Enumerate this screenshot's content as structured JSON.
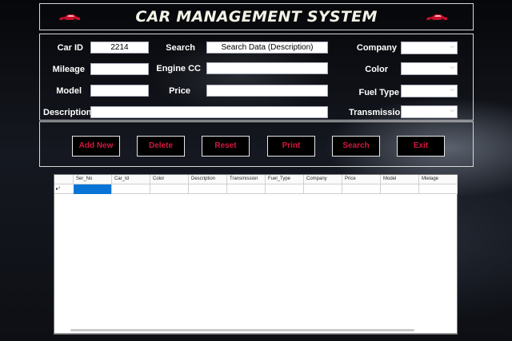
{
  "header": {
    "title": "CAR MANAGEMENT SYSTEM"
  },
  "form": {
    "car_id_label": "Car ID",
    "car_id_value": "2214",
    "search_label": "Search",
    "search_value": "Search Data (Description)",
    "company_label": "Company",
    "mileage_label": "Mileage",
    "engine_label": "Engine CC",
    "color_label": "Color",
    "model_label": "Model",
    "price_label": "Price",
    "fuel_label": "Fuel Type",
    "description_label": "Description",
    "transmission_label": "Transmission"
  },
  "buttons": {
    "add_new": "Add New",
    "delete": "Delete",
    "reset": "Reset",
    "print": "Print",
    "search": "Search",
    "exit": "Exit"
  },
  "grid": {
    "columns": [
      "Ser_No",
      "Car_Id",
      "Color",
      "Description",
      "Transmission",
      "Fuel_Type",
      "Company",
      "Price",
      "Model",
      "Mielage"
    ],
    "row_indicator": "▸*"
  },
  "colors": {
    "accent": "#d2183f",
    "selection": "#0a74d6",
    "background": "#0b0d12"
  },
  "icons": [
    "red-car-icon"
  ]
}
